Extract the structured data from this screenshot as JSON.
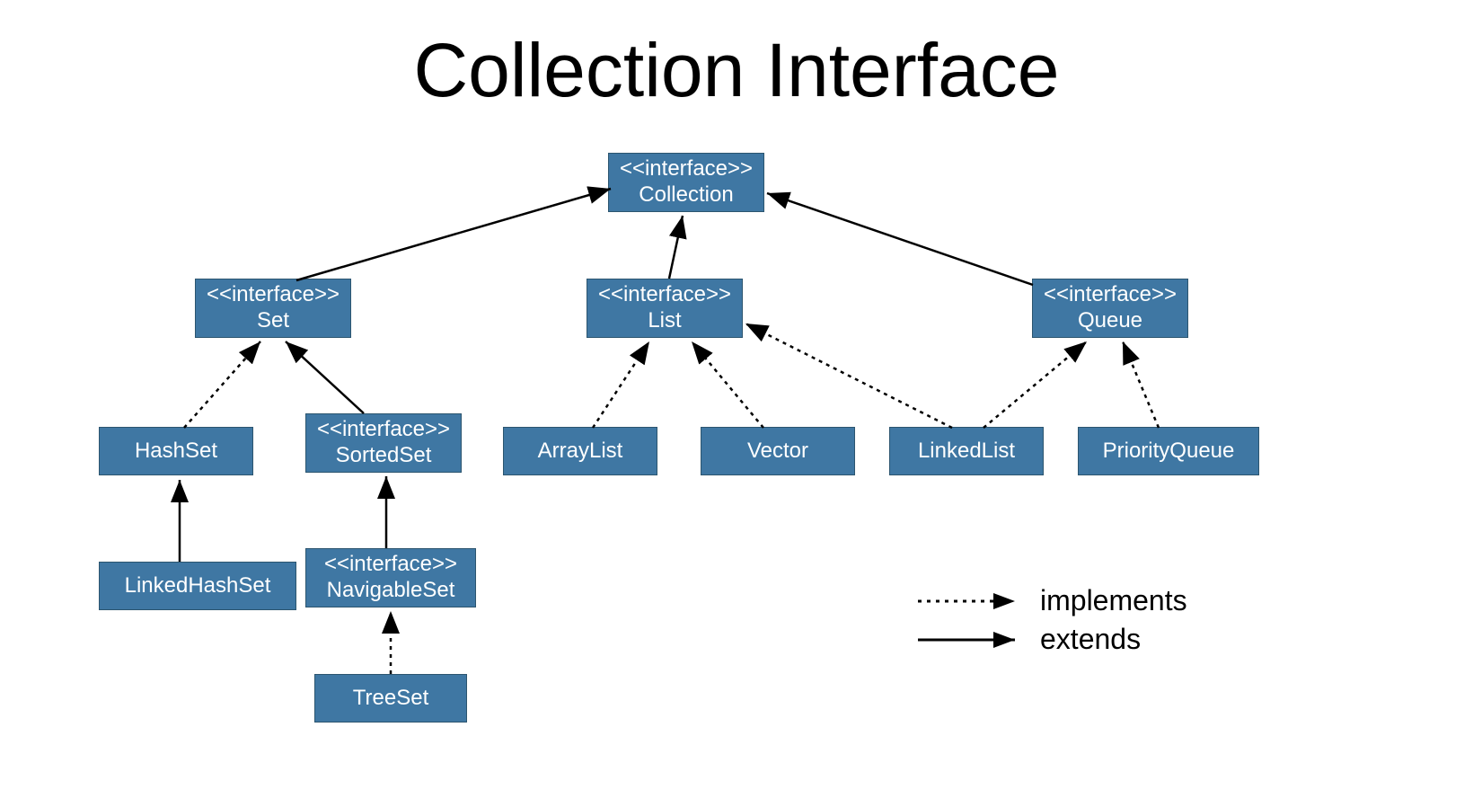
{
  "title": "Collection Interface",
  "stereotype": "<<interface>>",
  "nodes": {
    "collection": "Collection",
    "set": "Set",
    "list": "List",
    "queue": "Queue",
    "hashset": "HashSet",
    "sortedset": "SortedSet",
    "arraylist": "ArrayList",
    "vector": "Vector",
    "linkedlist": "LinkedList",
    "priorityqueue": "PriorityQueue",
    "linkedhashset": "LinkedHashSet",
    "navigableset": "NavigableSet",
    "treeset": "TreeSet"
  },
  "legend": {
    "implements": "implements",
    "extends": "extends"
  },
  "edges": [
    {
      "from": "set",
      "to": "collection",
      "style": "solid"
    },
    {
      "from": "list",
      "to": "collection",
      "style": "solid"
    },
    {
      "from": "queue",
      "to": "collection",
      "style": "solid"
    },
    {
      "from": "hashset",
      "to": "set",
      "style": "dotted"
    },
    {
      "from": "sortedset",
      "to": "set",
      "style": "solid"
    },
    {
      "from": "arraylist",
      "to": "list",
      "style": "dotted"
    },
    {
      "from": "vector",
      "to": "list",
      "style": "dotted"
    },
    {
      "from": "linkedlist",
      "to": "list",
      "style": "dotted"
    },
    {
      "from": "linkedlist",
      "to": "queue",
      "style": "dotted"
    },
    {
      "from": "priorityqueue",
      "to": "queue",
      "style": "dotted"
    },
    {
      "from": "linkedhashset",
      "to": "hashset",
      "style": "solid"
    },
    {
      "from": "navigableset",
      "to": "sortedset",
      "style": "solid"
    },
    {
      "from": "treeset",
      "to": "navigableset",
      "style": "dotted"
    }
  ]
}
